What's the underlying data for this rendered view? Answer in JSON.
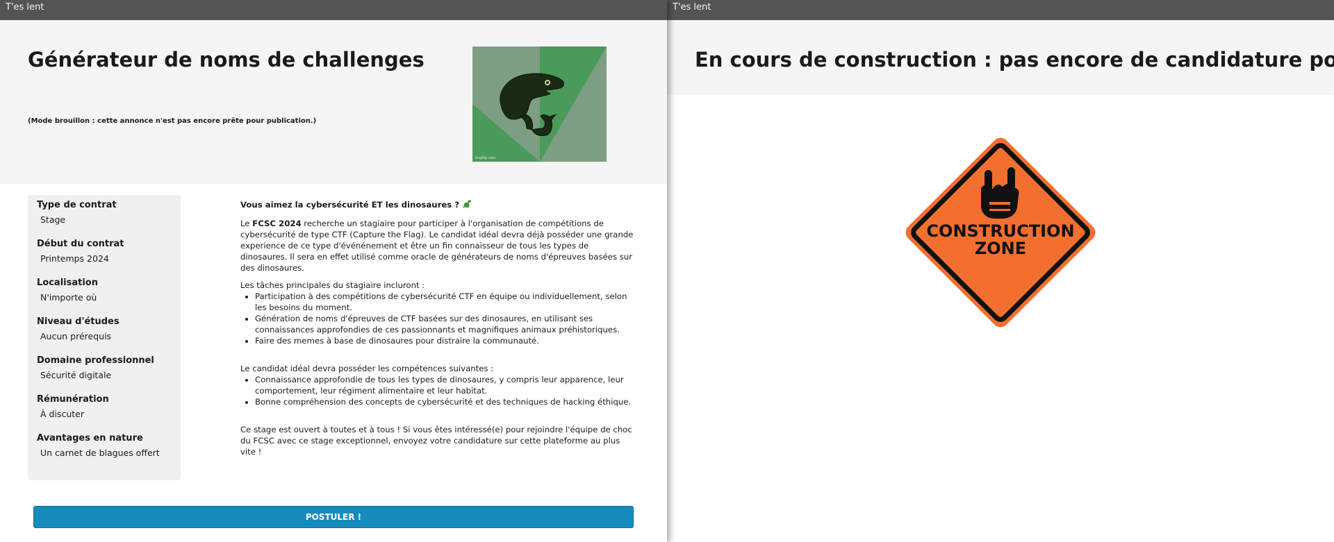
{
  "left_window": {
    "title": "T'es lent",
    "header": {
      "title": "Générateur de noms de challenges",
      "draft_note": "(Mode brouillon : cette annonce n'est pas encore prête pour publication.)",
      "image_caption": "imgflip.com"
    },
    "sidebar": {
      "items": [
        {
          "label": "Type de contrat",
          "value": "Stage"
        },
        {
          "label": "Début du contrat",
          "value": "Printemps 2024"
        },
        {
          "label": "Localisation",
          "value": "N'importe où"
        },
        {
          "label": "Niveau d'études",
          "value": "Aucun prérequis"
        },
        {
          "label": "Domaine professionnel",
          "value": "Sécurité digitale"
        },
        {
          "label": "Rémunération",
          "value": "À discuter"
        },
        {
          "label": "Avantages en nature",
          "value": "Un carnet de blagues offert"
        }
      ]
    },
    "content": {
      "heading": "Vous aimez la cybersécurité ET les dinosaures ?",
      "intro_prefix": "Le ",
      "intro_org": "FCSC 2024",
      "intro_rest": " recherche un stagiaire pour participer à l'organisation de compétitions de cybersécurité de type CTF (Capture the Flag). Le candidat idéal devra déjà posséder une grande experience de ce type d'événénement et être un fin connaisseur de tous les types de dinosaures. Il sera en effet utilisé comme oracle de générateurs de noms d'épreuves basées sur des dinosaures.",
      "tasks_intro": "Les tâches principales du stagiaire incluront :",
      "tasks": [
        "Participation à des compétitions de cybersécurité CTF en équipe ou individuellement, selon les besoins du moment.",
        "Génération de noms d'épreuves de CTF basées sur des dinosaures, en utilisant ses connaissances approfondies de ces passionnants et magnifiques animaux préhistoriques.",
        "Faire des memes à base de dinosaures pour distraire la communauté."
      ],
      "skills_intro": "Le candidat idéal devra posséder les compétences suivantes :",
      "skills": [
        "Connaissance approfondie de tous les types de dinosaures, y compris leur apparence, leur comportement, leur régiment alimentaire et leur habitat.",
        "Bonne compréhension des concepts de cybersécurité et des techniques de hacking éthique."
      ],
      "closing": "Ce stage est ouvert à toutes et à tous ! Si vous êtes intéressé(e) pour rejoindre l'équipe de choc du FCSC avec ce stage exceptionnel, envoyez votre candidature sur cette plateforme au plus vite !"
    },
    "apply_button": "POSTULER !"
  },
  "right_window": {
    "title": "T'es lent",
    "header": {
      "title": "En cours de construction : pas encore de candidature possible."
    },
    "sign": {
      "line1": "CONSTRUCTION",
      "line2": "ZONE"
    }
  },
  "colors": {
    "titlebar": "#545454",
    "hero_bg": "#f5f5f5",
    "sidebar_bg": "#f0f0f0",
    "button": "#178bbd",
    "sign_orange": "#f36f2f",
    "meme_green_light": "#7d9e82",
    "meme_green_dark": "#4a9a5c"
  }
}
